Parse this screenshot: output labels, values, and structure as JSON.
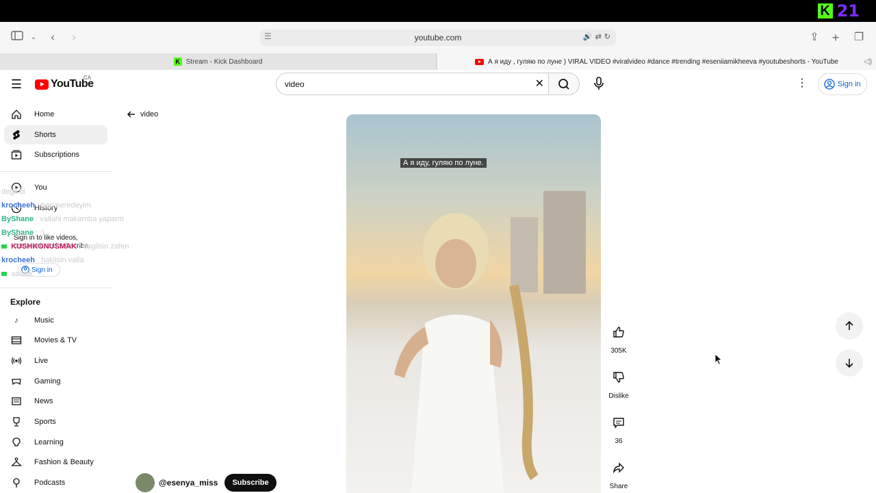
{
  "stream_overlay": {
    "viewer_count": "21"
  },
  "browser": {
    "address": "youtube.com",
    "tabs": [
      {
        "label": "Stream - Kick Dashboard"
      },
      {
        "label": "А я иду , гуляю по луне ) VIRAL VIDEO #viralvideo #dance #trending #eseniiamikheeva #youtubeshorts - YouTube"
      }
    ]
  },
  "masthead": {
    "logo_text": "YouTube",
    "country": "CA",
    "search_value": "video",
    "signin_label": "Sign in"
  },
  "sidebar": {
    "items": [
      {
        "label": "Home",
        "icon": "home-icon"
      },
      {
        "label": "Shorts",
        "icon": "shorts-icon"
      },
      {
        "label": "Subscriptions",
        "icon": "subscriptions-icon"
      },
      {
        "label": "You",
        "icon": "you-icon"
      },
      {
        "label": "History",
        "icon": "history-icon"
      }
    ],
    "signin_prompt": "Sign in to like videos, comment, and subscribe.",
    "signin_label": "Sign in",
    "explore_title": "Explore",
    "explore": [
      {
        "label": "Music",
        "icon": "music-icon"
      },
      {
        "label": "Movies & TV",
        "icon": "movies-icon"
      },
      {
        "label": "Live",
        "icon": "live-icon"
      },
      {
        "label": "Gaming",
        "icon": "gaming-icon"
      },
      {
        "label": "News",
        "icon": "news-icon"
      },
      {
        "label": "Sports",
        "icon": "sports-icon"
      },
      {
        "label": "Learning",
        "icon": "learning-icon"
      },
      {
        "label": "Fashion & Beauty",
        "icon": "fashion-icon"
      },
      {
        "label": "Podcasts",
        "icon": "podcasts-icon"
      }
    ]
  },
  "chat": [
    {
      "user": "",
      "message": "degil bi"
    },
    {
      "user": "krocheeh",
      "message": ": ben neredeyim",
      "color": "#3b74d9"
    },
    {
      "user": "ByShane",
      "message": ": vallahi makarnba yaparm",
      "color": "#2fb38a"
    },
    {
      "user": "ByShane",
      "message": ": :)",
      "color": "#2fb38a"
    },
    {
      "user": "KUSHKONUSMAK",
      "message": ": degilsin zafen",
      "color": "#c2185b"
    },
    {
      "user": "krocheeh",
      "message": ": haklisin valla",
      "color": "#3b74d9"
    },
    {
      "user": "",
      "message": "aaaaa:"
    }
  ],
  "page": {
    "back_label": "video"
  },
  "short": {
    "caption": "А я иду, гуляю по луне.",
    "creator_handle": "@esenya_miss",
    "subscribe_label": "Subscribe"
  },
  "actions": {
    "like_count": "305K",
    "dislike_label": "Dislike",
    "comment_count": "36",
    "share_label": "Share"
  }
}
